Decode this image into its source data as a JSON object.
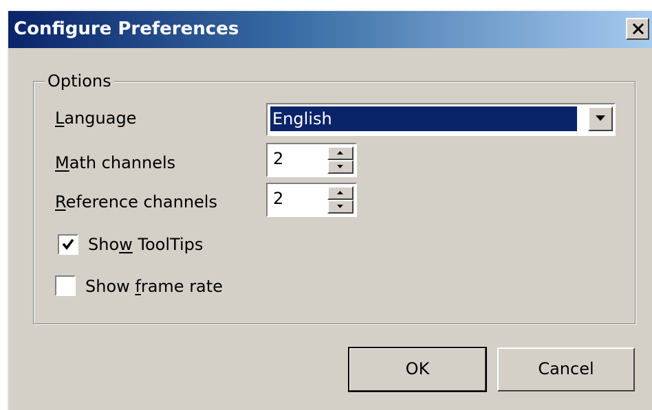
{
  "window": {
    "title": "Configure Preferences",
    "close_icon": "close-icon"
  },
  "options": {
    "group_label": "Options",
    "language": {
      "label_pre": "",
      "label_mnemonic": "L",
      "label_post": "anguage",
      "value": "English"
    },
    "math_channels": {
      "label_pre": "",
      "label_mnemonic": "M",
      "label_post": "ath channels",
      "value": "2"
    },
    "reference_channels": {
      "label_pre": "",
      "label_mnemonic": "R",
      "label_post": "eference channels",
      "value": "2"
    },
    "show_tooltips": {
      "label_pre": "Sho",
      "label_mnemonic": "w",
      "label_post": " ToolTips",
      "checked": true
    },
    "show_frame_rate": {
      "label_pre": "Show ",
      "label_mnemonic": "f",
      "label_post": "rame rate",
      "checked": false
    }
  },
  "buttons": {
    "ok": "OK",
    "cancel": "Cancel"
  },
  "colors": {
    "titlebar_start": "#0a246a",
    "titlebar_end": "#a6caf0",
    "face": "#d4d0c8",
    "selection": "#0a246a"
  }
}
